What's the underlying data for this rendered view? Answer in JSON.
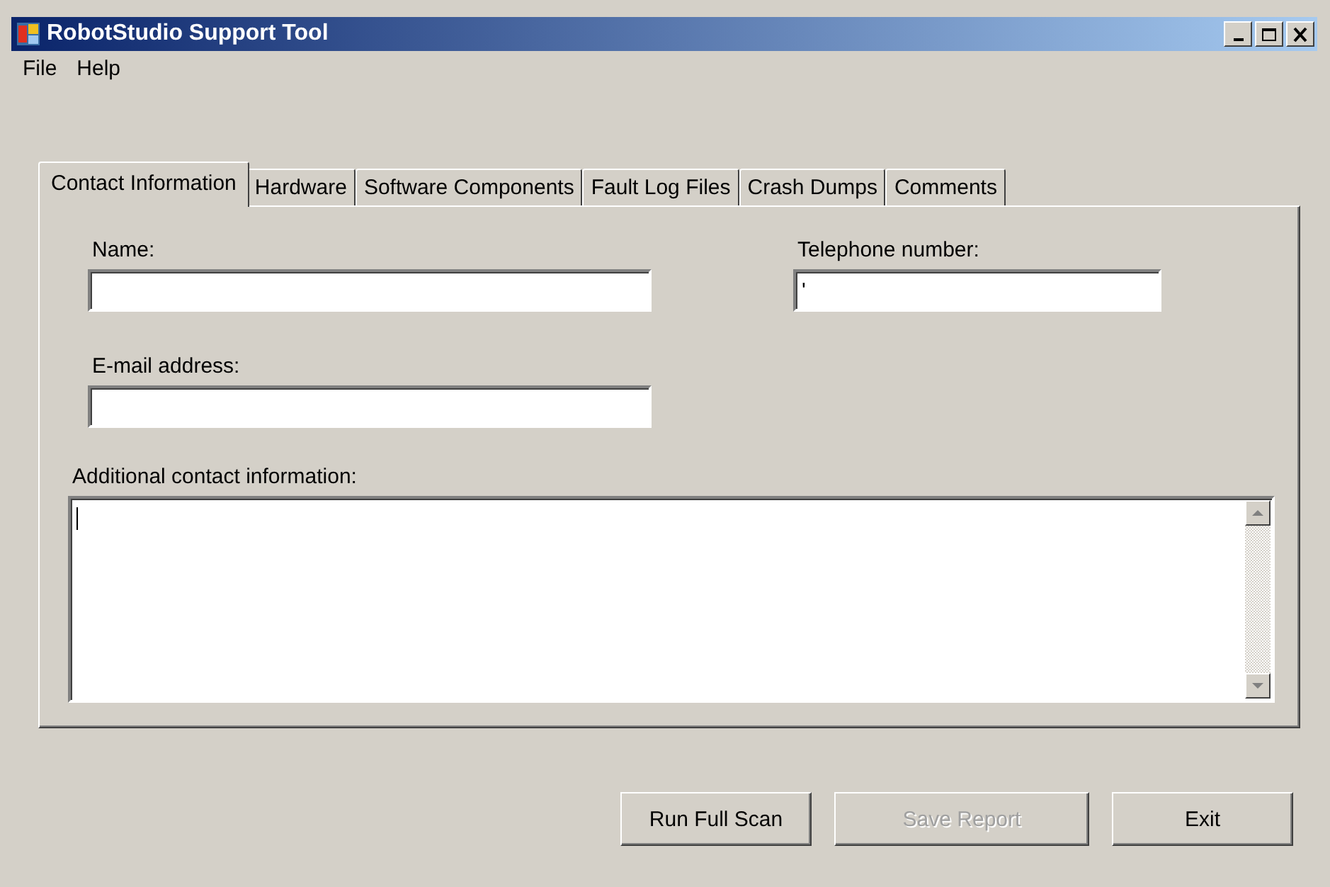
{
  "window": {
    "title": "RobotStudio Support Tool"
  },
  "menu": [
    "File",
    "Help"
  ],
  "tabs": [
    {
      "label": "Contact Information",
      "selected": true
    },
    {
      "label": "Hardware",
      "selected": false
    },
    {
      "label": "Software Components",
      "selected": false
    },
    {
      "label": "Fault Log Files",
      "selected": false
    },
    {
      "label": "Crash Dumps",
      "selected": false
    },
    {
      "label": "Comments",
      "selected": false
    }
  ],
  "fields": [
    {
      "label": "Name:",
      "kind": "line"
    },
    {
      "label": "Telephone number:",
      "kind": "line",
      "value": "'"
    },
    {
      "label": "E-mail address:",
      "kind": "line"
    },
    {
      "label": "Additional contact information:",
      "kind": "multiline",
      "focused": true
    }
  ],
  "buttons": [
    {
      "label": "Run Full Scan",
      "disabled": false
    },
    {
      "label": "Save Report",
      "disabled": true
    },
    {
      "label": "Exit",
      "disabled": false
    }
  ]
}
